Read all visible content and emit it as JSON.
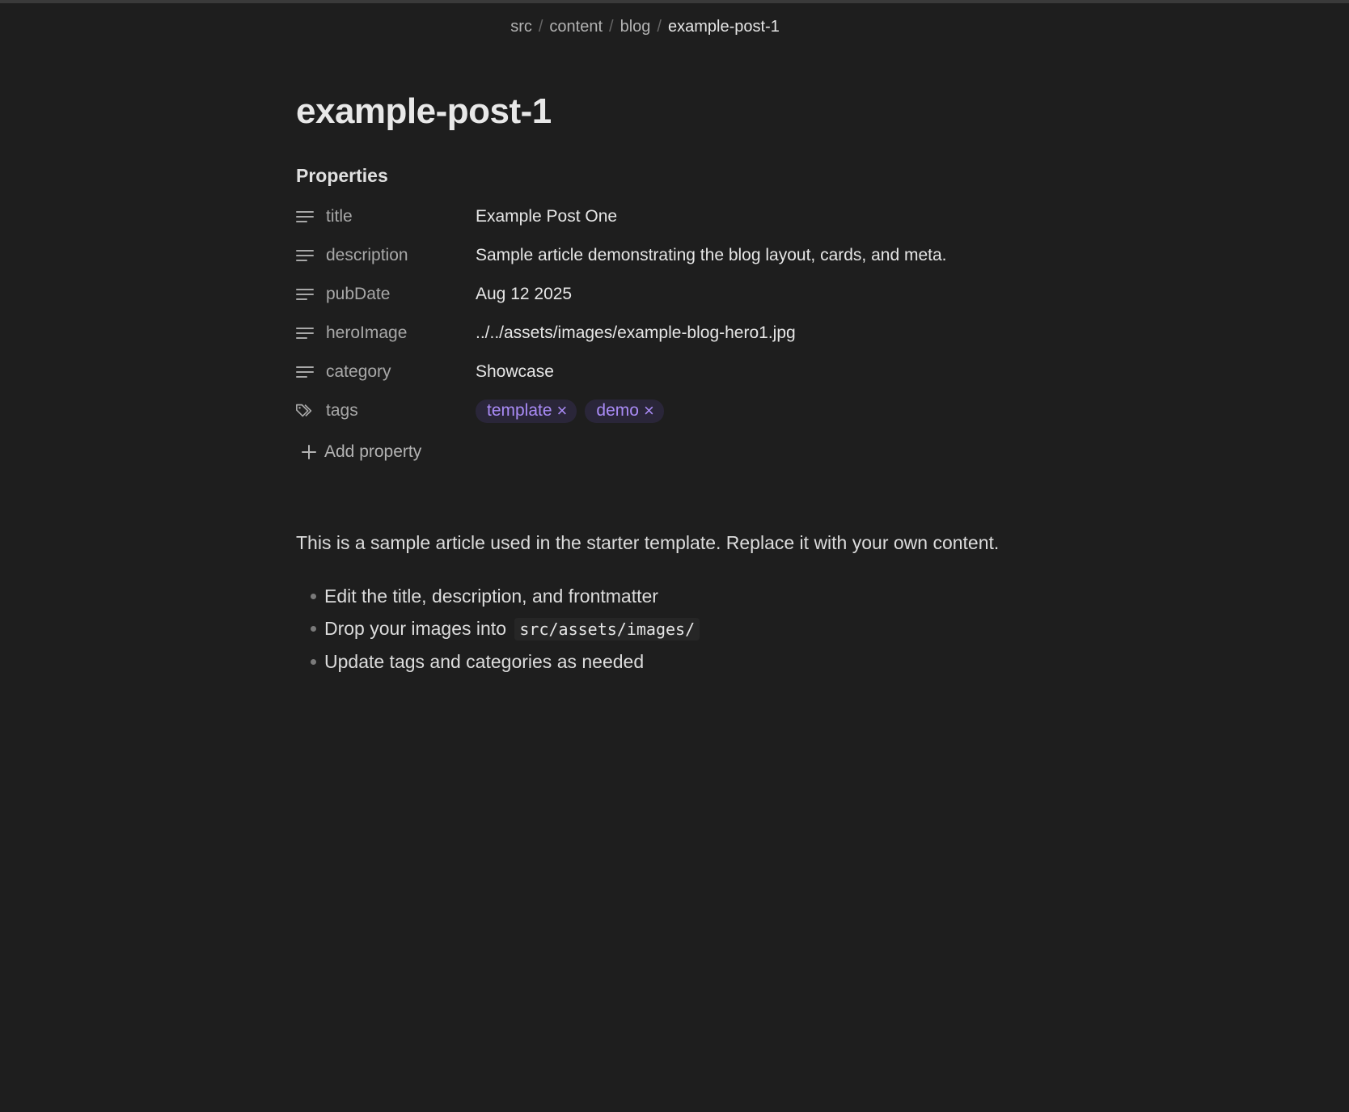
{
  "breadcrumb": {
    "items": [
      "src",
      "content",
      "blog",
      "example-post-1"
    ],
    "separator": "/"
  },
  "page": {
    "title": "example-post-1"
  },
  "properties": {
    "heading": "Properties",
    "rows": [
      {
        "key": "title",
        "icon": "text-lines-icon",
        "value": "Example Post One"
      },
      {
        "key": "description",
        "icon": "text-lines-icon",
        "value": "Sample article demonstrating the blog layout, cards, and meta."
      },
      {
        "key": "pubDate",
        "icon": "text-lines-icon",
        "value": "Aug 12 2025"
      },
      {
        "key": "heroImage",
        "icon": "text-lines-icon",
        "value": "../../assets/images/example-blog-hero1.jpg"
      },
      {
        "key": "category",
        "icon": "text-lines-icon",
        "value": "Showcase"
      }
    ],
    "tags": {
      "key": "tags",
      "icon": "tags-icon",
      "values": [
        "template",
        "demo"
      ],
      "remove_glyph": "×"
    },
    "add_label": "Add property"
  },
  "body": {
    "paragraph": "This is a sample article used in the starter template. Replace it with your own content.",
    "bullets": [
      {
        "text": "Edit the title, description, and frontmatter",
        "code": ""
      },
      {
        "text": "Drop your images into",
        "code": "src/assets/images/"
      },
      {
        "text": "Update tags and categories as needed",
        "code": ""
      }
    ]
  },
  "colors": {
    "background": "#1e1e1e",
    "tag_bg": "#2a2639",
    "tag_fg": "#a98bf5"
  }
}
